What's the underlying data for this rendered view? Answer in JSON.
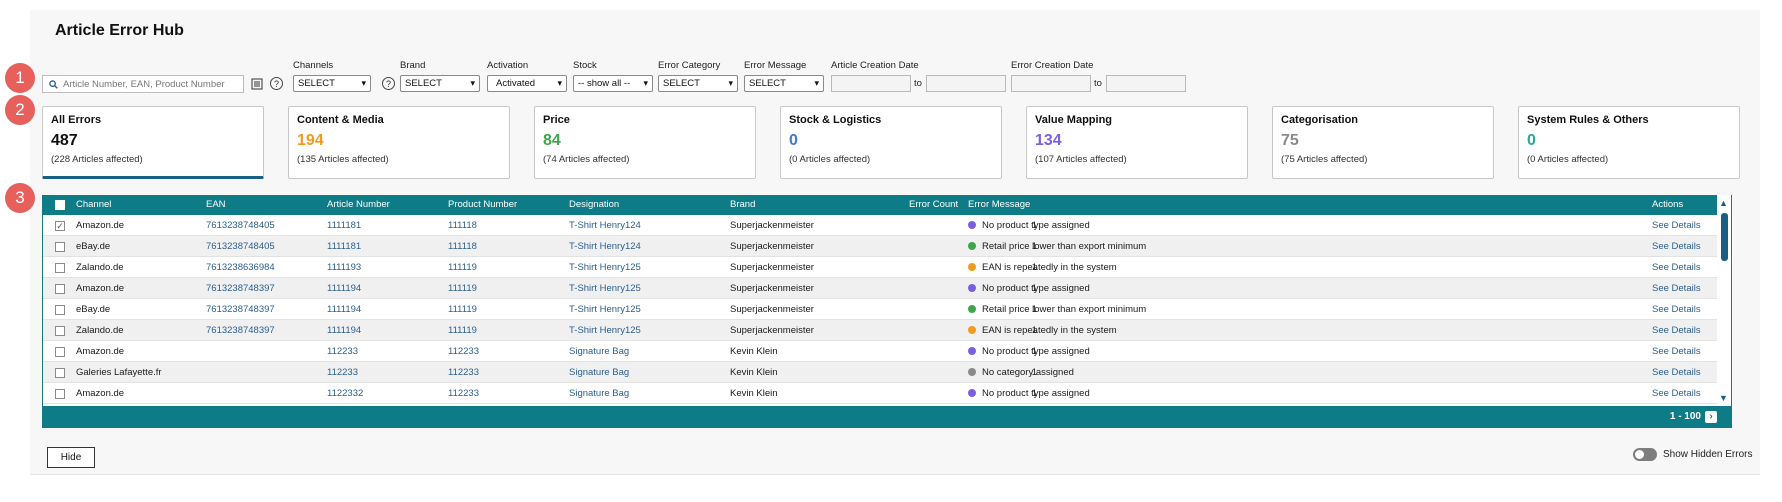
{
  "title": "Article Error Hub",
  "steps": [
    "1",
    "2",
    "3"
  ],
  "search": {
    "placeholder": "Article Number, EAN, Product Number"
  },
  "filters": {
    "channels": {
      "label": "Channels",
      "value": "SELECT"
    },
    "brand": {
      "label": "Brand",
      "value": "SELECT"
    },
    "activation": {
      "label": "Activation",
      "value": "Activated"
    },
    "stock": {
      "label": "Stock",
      "value": "-- show all --"
    },
    "error_category": {
      "label": "Error Category",
      "value": "SELECT"
    },
    "error_message": {
      "label": "Error Message",
      "value": "SELECT"
    },
    "article_creation_date": {
      "label": "Article Creation Date",
      "to": "to"
    },
    "error_creation_date": {
      "label": "Error Creation Date",
      "to": "to"
    }
  },
  "cards": [
    {
      "name": "All Errors",
      "count": "487",
      "affected": "(228 Articles affected)",
      "color": "#111111"
    },
    {
      "name": "Content & Media",
      "count": "194",
      "affected": "(135 Articles affected)",
      "color": "#f29a1f"
    },
    {
      "name": "Price",
      "count": "84",
      "affected": "(74 Articles affected)",
      "color": "#3aa84a"
    },
    {
      "name": "Stock & Logistics",
      "count": "0",
      "affected": "(0 Articles affected)",
      "color": "#3d7ad6"
    },
    {
      "name": "Value Mapping",
      "count": "134",
      "affected": "(107 Articles affected)",
      "color": "#7b5fe0"
    },
    {
      "name": "Categorisation",
      "count": "75",
      "affected": "(75 Articles affected)",
      "color": "#8a8a8a"
    },
    {
      "name": "System Rules & Others",
      "count": "0",
      "affected": "(0 Articles affected)",
      "color": "#2aa8a0"
    }
  ],
  "table": {
    "columns": {
      "channel": "Channel",
      "ean": "EAN",
      "article_number": "Article Number",
      "product_number": "Product Number",
      "designation": "Designation",
      "brand": "Brand",
      "error_count": "Error Count",
      "error_message": "Error Message",
      "actions": "Actions"
    },
    "rows": [
      {
        "checked": true,
        "channel": "Amazon.de",
        "ean": "7613238748405",
        "article_number": "1111181",
        "product_number": "111118",
        "designation": "T-Shirt Henry124",
        "brand": "Superjackenmeister",
        "error_count": "1",
        "dot_color": "#7b5fe0",
        "error_message": "No product type assigned",
        "action": "See Details"
      },
      {
        "checked": false,
        "channel": "eBay.de",
        "ean": "7613238748405",
        "article_number": "1111181",
        "product_number": "111118",
        "designation": "T-Shirt Henry124",
        "brand": "Superjackenmeister",
        "error_count": "1",
        "dot_color": "#3aa84a",
        "error_message": "Retail price lower than export minimum",
        "action": "See Details"
      },
      {
        "checked": false,
        "channel": "Zalando.de",
        "ean": "7613238636984",
        "article_number": "1111193",
        "product_number": "111119",
        "designation": "T-Shirt Henry125",
        "brand": "Superjackenmeister",
        "error_count": "1",
        "dot_color": "#f29a1f",
        "error_message": "EAN is repeatedly in the system",
        "action": "See Details"
      },
      {
        "checked": false,
        "channel": "Amazon.de",
        "ean": "7613238748397",
        "article_number": "1111194",
        "product_number": "111119",
        "designation": "T-Shirt Henry125",
        "brand": "Superjackenmeister",
        "error_count": "1",
        "dot_color": "#7b5fe0",
        "error_message": "No product type assigned",
        "action": "See Details"
      },
      {
        "checked": false,
        "channel": "eBay.de",
        "ean": "7613238748397",
        "article_number": "1111194",
        "product_number": "111119",
        "designation": "T-Shirt Henry125",
        "brand": "Superjackenmeister",
        "error_count": "1",
        "dot_color": "#3aa84a",
        "error_message": "Retail price lower than export minimum",
        "action": "See Details"
      },
      {
        "checked": false,
        "channel": "Zalando.de",
        "ean": "7613238748397",
        "article_number": "1111194",
        "product_number": "111119",
        "designation": "T-Shirt Henry125",
        "brand": "Superjackenmeister",
        "error_count": "1",
        "dot_color": "#f29a1f",
        "error_message": "EAN is repeatedly in the system",
        "action": "See Details"
      },
      {
        "checked": false,
        "channel": "Amazon.de",
        "ean": "",
        "article_number": "112233",
        "product_number": "112233",
        "designation": "Signature Bag",
        "brand": "Kevin Klein",
        "error_count": "1",
        "dot_color": "#7b5fe0",
        "error_message": "No product type assigned",
        "action": "See Details"
      },
      {
        "checked": false,
        "channel": "Galeries Lafayette.fr",
        "ean": "",
        "article_number": "112233",
        "product_number": "112233",
        "designation": "Signature Bag",
        "brand": "Kevin Klein",
        "error_count": "1",
        "dot_color": "#8a8a8a",
        "error_message": "No category assigned",
        "action": "See Details"
      },
      {
        "checked": false,
        "channel": "Amazon.de",
        "ean": "",
        "article_number": "1122332",
        "product_number": "112233",
        "designation": "Signature Bag",
        "brand": "Kevin Klein",
        "error_count": "1",
        "dot_color": "#7b5fe0",
        "error_message": "No product type assigned",
        "action": "See Details"
      }
    ],
    "pagination": "1 - 100"
  },
  "hide_button": "Hide",
  "show_hidden_errors": "Show Hidden Errors",
  "colors": {
    "teal_header": "#0e7c86",
    "step_badge": "#e8605c",
    "link": "#2b5f8e",
    "active_underline": "#1a5e86"
  },
  "icons": {
    "search": "search-icon",
    "list": "list-icon",
    "help": "help-icon",
    "next": "chevron-right-icon"
  }
}
